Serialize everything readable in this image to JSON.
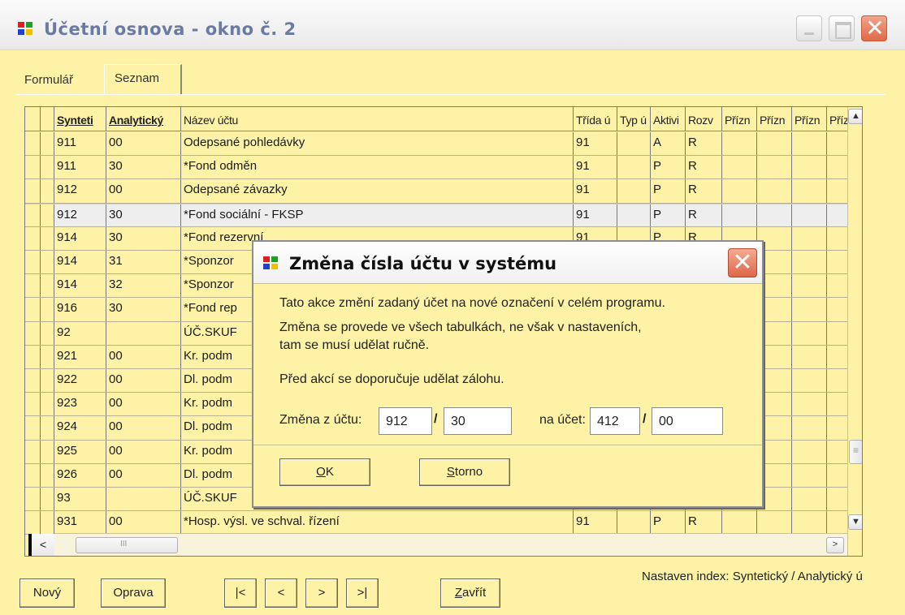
{
  "window": {
    "title": "Účetní osnova - okno č. 2",
    "colors": {
      "background": "#fdf2a6",
      "title_text": "#6a7aa0",
      "close_red": "#de6a48"
    }
  },
  "tabs": [
    {
      "label": "Formulář",
      "active": false
    },
    {
      "label": "Seznam",
      "active": true
    }
  ],
  "grid": {
    "columns": [
      "Synteti",
      "Analytický",
      "Název účtu",
      "Třída ú",
      "Typ ú",
      "Aktivi",
      "Rozv",
      "Přízn",
      "Přízn",
      "Přízn",
      "Přízi"
    ],
    "rows": [
      [
        "911",
        "00",
        "Odepsané pohledávky",
        "91",
        "",
        "A",
        "R",
        "",
        "",
        "",
        ""
      ],
      [
        "911",
        "30",
        "*Fond odměn",
        "91",
        "",
        "P",
        "R",
        "",
        "",
        "",
        ""
      ],
      [
        "912",
        "00",
        "Odepsané závazky",
        "91",
        "",
        "P",
        "R",
        "",
        "",
        "",
        ""
      ],
      [
        "912",
        "30",
        "*Fond sociální - FKSP",
        "91",
        "",
        "P",
        "R",
        "",
        "",
        "",
        ""
      ],
      [
        "914",
        "30",
        "*Fond rezervní",
        "91",
        "",
        "P",
        "R",
        "",
        "",
        "",
        ""
      ],
      [
        "914",
        "31",
        "*Sponzor",
        "",
        "",
        "",
        "",
        "",
        "",
        "",
        ""
      ],
      [
        "914",
        "32",
        "*Sponzor",
        "",
        "",
        "",
        "",
        "",
        "",
        "",
        ""
      ],
      [
        "916",
        "30",
        "*Fond rep",
        "",
        "",
        "",
        "",
        "",
        "",
        "",
        ""
      ],
      [
        "92",
        "",
        "ÚČ.SKUF",
        "",
        "",
        "",
        "",
        "",
        "",
        "",
        ""
      ],
      [
        "921",
        "00",
        "Kr. podm",
        "",
        "",
        "",
        "",
        "",
        "",
        "",
        ""
      ],
      [
        "922",
        "00",
        "Dl. podm",
        "",
        "",
        "",
        "",
        "",
        "",
        "",
        ""
      ],
      [
        "923",
        "00",
        "Kr. podm",
        "",
        "",
        "",
        "",
        "",
        "",
        "",
        ""
      ],
      [
        "924",
        "00",
        "Dl. podm",
        "",
        "",
        "",
        "",
        "",
        "",
        "",
        ""
      ],
      [
        "925",
        "00",
        "Kr. podm",
        "",
        "",
        "",
        "",
        "",
        "",
        "",
        ""
      ],
      [
        "926",
        "00",
        "Dl. podm",
        "",
        "",
        "",
        "",
        "",
        "",
        "",
        ""
      ],
      [
        "93",
        "",
        "ÚČ.SKUF",
        "",
        "",
        "",
        "",
        "",
        "",
        "",
        ""
      ],
      [
        "931",
        "00",
        "*Hosp. výsl. ve schval. řízení",
        "91",
        "",
        "P",
        "R",
        "",
        "",
        "",
        ""
      ]
    ],
    "selected_row": 3
  },
  "buttons": {
    "new": "Nový",
    "edit": "Oprava",
    "first": "|<",
    "prev": "<",
    "next": ">",
    "last": ">|",
    "close_first": "Z",
    "close_rest": "avřít"
  },
  "status": "Nastaven index: Syntetický / Analytický ú",
  "dialog": {
    "title": "Změna čísla účtu v systému",
    "line1": "Tato akce změní zadaný účet na nové označení v celém programu.",
    "line2": "Změna se provede ve všech tabulkách, ne však v nastaveních,",
    "line3": "tam se musí udělat ručně.",
    "line4": "Před akcí se doporučuje udělat zálohu.",
    "from_label": "Změna z účtu:",
    "from_synt": "912",
    "from_anal": "30",
    "to_label": "na účet:",
    "to_synt": "412",
    "to_anal": "00",
    "slash": "/",
    "ok_first": "O",
    "ok_rest": "K",
    "cancel_first": "S",
    "cancel_rest": "torno"
  }
}
